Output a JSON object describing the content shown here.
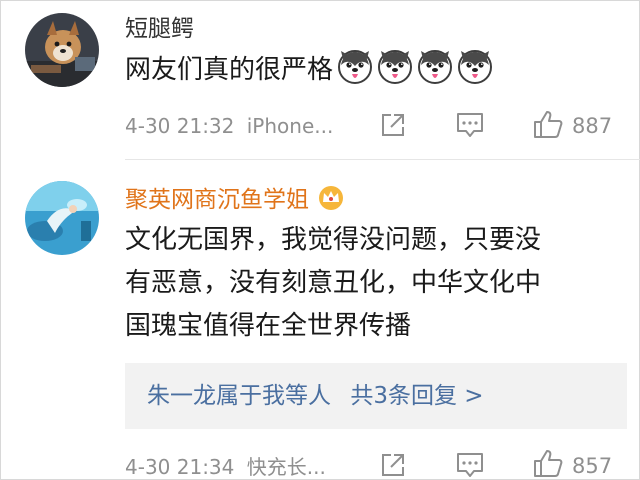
{
  "comments": [
    {
      "username": "短腿鳄",
      "username_color": "#333333",
      "text": "网友们真的很严格",
      "emoji_count": 4,
      "emoji_icon": "husky-face-emoji",
      "time": "4-30 21:32",
      "source": "iPhone...",
      "like_count": "887"
    },
    {
      "username": "聚英网商沉鱼学姐",
      "username_color": "#e0741a",
      "badge_icon": "crown-badge-icon",
      "text_lines": [
        "文化无国界，我觉得没问题，只要没",
        "有恶意，没有刻意丑化，中华文化中",
        "国瑰宝值得在全世界传播"
      ],
      "reply_preview": {
        "author_text": "朱一龙属于我等人",
        "count_text": "共3条回复 >"
      },
      "time": "4-30 21:34",
      "source": "快充长...",
      "like_count": "857"
    }
  ]
}
